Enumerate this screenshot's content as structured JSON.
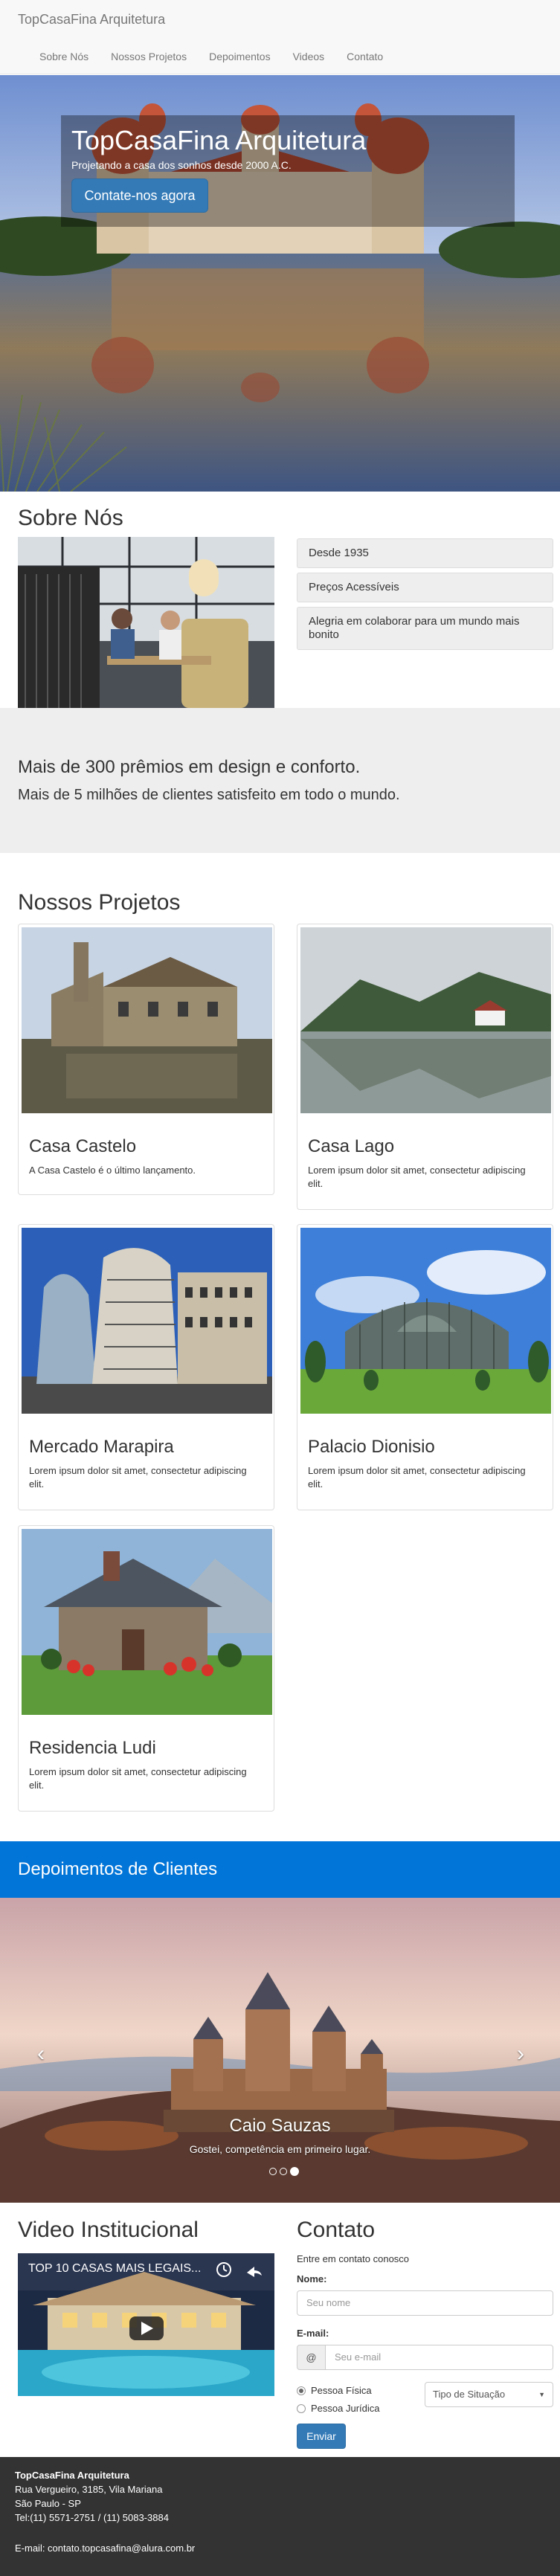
{
  "navbar": {
    "brand": "TopCasaFina Arquitetura",
    "links": [
      "Sobre Nós",
      "Nossos Projetos",
      "Depoimentos",
      "Videos",
      "Contato"
    ]
  },
  "hero": {
    "title": "TopCasaFina Arquitetura",
    "subtitle": "Projetando a casa dos sonhos desde 2000 A.C.",
    "button": "Contate-nos agora"
  },
  "sobre": {
    "title": "Sobre Nós",
    "items": [
      "Desde 1935",
      "Preços Acessíveis",
      "Alegria em colaborar para um mundo mais bonito"
    ]
  },
  "highlights": {
    "line1": "Mais de 300 prêmios em design e conforto.",
    "line2": "Mais de 5 milhões de clientes satisfeito em todo o mundo."
  },
  "projetos": {
    "title": "Nossos Projetos",
    "cards": [
      {
        "title": "Casa Castelo",
        "text": "A Casa Castelo é o último lançamento."
      },
      {
        "title": "Casa Lago",
        "text": "Lorem ipsum dolor sit amet, consectetur adipiscing elit."
      },
      {
        "title": "Mercado Marapira",
        "text": "Lorem ipsum dolor sit amet, consectetur adipiscing elit."
      },
      {
        "title": "Palacio Dionisio",
        "text": "Lorem ipsum dolor sit amet, consectetur adipiscing elit."
      },
      {
        "title": "Residencia Ludi",
        "text": "Lorem ipsum dolor sit amet, consectetur adipiscing elit."
      }
    ]
  },
  "depoimentos": {
    "title": "Depoimentos de Clientes",
    "name": "Caio Sauzas",
    "caption": "Gostei, competência em primeiro lugar.",
    "prev": "‹",
    "next": "›"
  },
  "video": {
    "title": "Video Institucional",
    "video_title": "TOP 10 CASAS MAIS LEGAIS..."
  },
  "contato": {
    "title": "Contato",
    "subtitle": "Entre em contato conosco",
    "name_label": "Nome:",
    "name_placeholder": "Seu nome",
    "email_label": "E-mail:",
    "email_addon": "@",
    "email_placeholder": "Seu e-mail",
    "radio1": "Pessoa Física",
    "radio2": "Pessoa Jurídica",
    "select_value": "Tipo de Situação",
    "send": "Enviar"
  },
  "footer": {
    "company": "TopCasaFina Arquitetura",
    "street": "Rua Vergueiro, 3185, Vila Mariana",
    "city": "São Paulo - SP",
    "phone": "Tel:(11) 5571-2751 / (11) 5083-3884",
    "email": "E-mail: contato.topcasafina@alura.com.br"
  },
  "colors": {
    "primary": "#337ab7",
    "depoimentos_bar": "#0275d8",
    "footer": "#333333"
  }
}
